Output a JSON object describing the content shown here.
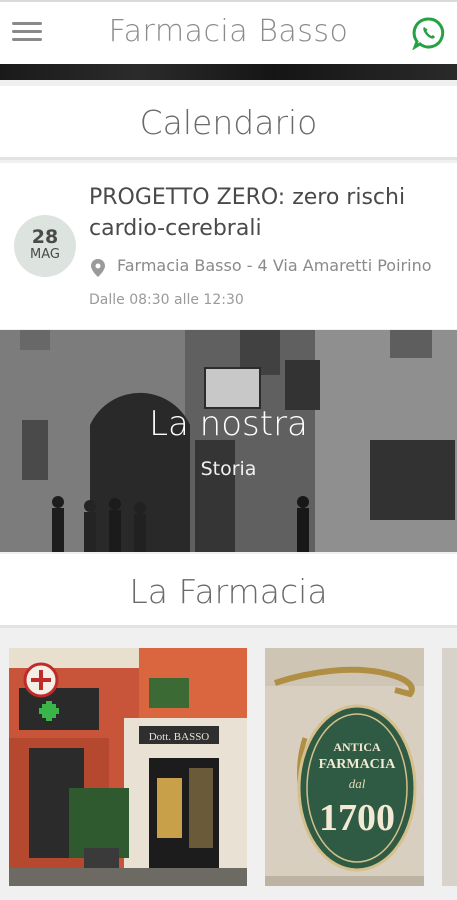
{
  "header": {
    "title": "Farmacia Basso",
    "menu_icon": "hamburger-menu-icon",
    "contact_icon": "whatsapp-icon",
    "contact_color": "#25a244"
  },
  "calendar": {
    "section_title": "Calendario",
    "event": {
      "day": "28",
      "month": "MAG",
      "title": "PROGETTO ZERO: zero rischi cardio-cerebrali",
      "location": "Farmacia Basso - 4 Via Amaretti Poirino",
      "time": "Dalle 08:30 alle 12:30"
    }
  },
  "story": {
    "title": "La nostra",
    "subtitle": "Storia"
  },
  "farmacia": {
    "section_title": "La Farmacia",
    "photos": [
      {
        "sign_text": "Dott. BASSO"
      },
      {
        "plaque_line1": "ANTICA",
        "plaque_line2": "FARMACIA",
        "plaque_line3": "dal",
        "plaque_year": "1700"
      }
    ]
  }
}
